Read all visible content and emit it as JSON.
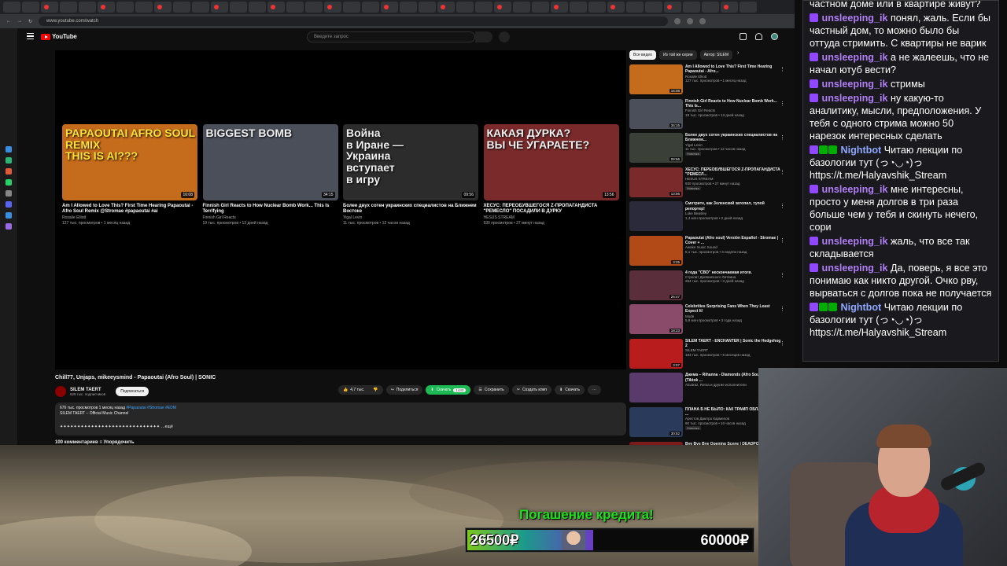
{
  "browser": {
    "url": "www.youtube.com/watch",
    "tab_count": 40
  },
  "youtube": {
    "logo": "YouTube",
    "search_placeholder": "Введите запрос",
    "end_cards": [
      {
        "thumb_text": "PAPAOUTAI AFRO SOUL REMIX\nTHIS IS AI???",
        "duration": "16:08",
        "title": "Am I Allowed to Love This? First Time Hearing Papaoutai - Afro Soul Remix @Stromae #papaoutai #ai",
        "channel": "Rosalie Elliott",
        "meta": "127 тыс. просмотров • 1 месяц назад",
        "bg": "#c46b1c"
      },
      {
        "thumb_text": "BIGGEST BOMB",
        "duration": "34:15",
        "title": "Finnish Girl Reacts to How Nuclear Bomb Work... This Is Terrifying",
        "channel": "Finnish Girl Reacts",
        "meta": "19 тыс. просмотров • 13 дней назад",
        "bg": "#4a4f5a"
      },
      {
        "thumb_text": "Война\nв Иране —\nУкраина\nвступает\nв игру",
        "duration": "09:56",
        "title": "Более двух сотен украинских специалистов на Ближнем Востоке",
        "channel": "Yigal Levin",
        "meta": "11 тыс. просмотров • 12 часов назад",
        "bg": "#2c2c2c"
      },
      {
        "thumb_text": "КАКАЯ ДУРКА?\nВЫ ЧЕ УГАРАЕТЕ?",
        "duration": "13:56",
        "title": "ХЕСУС: ПЕРЕОБУВШЕГОСЯ Z-ПРОПАГАНДИСТА \"РЕМЕСЛО\" ПОСАДИЛИ В ДУРКУ",
        "channel": "HESUS STREAM",
        "meta": "930 просмотров • 27 минут назад",
        "bg": "#7a2a2a"
      }
    ],
    "video_title": "Chill77, Unjaps, mikeeysmind - Papaoutai (Afro Soul) | SONIC",
    "channel_name": "SILEM TAERT",
    "channel_subs": "625 тыс. подписчиков",
    "subscribe_label": "Подписаться",
    "likes": "4,7 тыс.",
    "share_label": "Поделиться",
    "download_green_label": "Скачать",
    "download_green_count": "1440",
    "save_label": "Сохранить",
    "clip_label": "Создать клип",
    "download_label": "Скачать",
    "description_stats": "676 тыс. просмотров  1 месяц назад",
    "description_tags": "#Papaoutai #Stromae #EDM",
    "description_line2": "SILEM TAERT – Official Music Channel",
    "description_more": "✦✦✦✦✦✦✦✦✦✦✦✦✦✦✦✦✦✦✦✦✦✦✦✦✦✦✦✦✦ ...ещё",
    "comments_label": "100 комментариев   ≡ Упорядочить",
    "chips": [
      "Все видео",
      "Из той же серии",
      "Автор: SILEM"
    ],
    "recommendations": [
      {
        "title": "Am I Allowed to Love This? First Time Hearing Papaoutai - Afro...",
        "channel": "Rosalie Elliott",
        "meta": "127 тыс. просмотров • 1 месяц назад",
        "duration": "16:08",
        "bg": "#c46b1c"
      },
      {
        "title": "Finnish Girl Reacts to How Nuclear Bomb Work... This Is...",
        "channel": "Finnish Girl Reacts",
        "meta": "19 тыс. просмотров • 13 дней назад",
        "duration": "34:15",
        "bg": "#4a4f5a"
      },
      {
        "title": "Более двух сотен украинских специалистов на Ближнем...",
        "channel": "Yigal Levin",
        "meta": "11 тыс. просмотров • 12 часов назад",
        "duration": "09:56",
        "badge": "Новинка",
        "bg": "#3a3f38"
      },
      {
        "title": "ХЕСУС: ПЕРЕОБУВШЕГОСЯ Z-ПРОПАГАНДИСТА \"РЕМЕСЛ...",
        "channel": "HESUS STREAM",
        "meta": "930 просмотров • 27 минут назад",
        "duration": "13:56",
        "badge": "Новинка",
        "bg": "#7a2a2a"
      },
      {
        "title": "Смотрите, как Зеленский затопил, тупой репортер!",
        "channel": "Luke Beasley",
        "meta": "1,4 млн просмотров • 2 дней назад",
        "duration": "",
        "bg": "#2a2a3a"
      },
      {
        "title": "Papaoutai (Afro soul) Versión Español - Stromae | Cover + ...",
        "channel": "Awake music Sound",
        "meta": "5,1 тыс. просмотров • 3 недели назад",
        "duration": "3:25",
        "bg": "#b24a18"
      },
      {
        "title": "4 года \"СВО\" нескончаемая итогв.",
        "channel": "Стрелит Дневничного Литвина",
        "meta": "254 тыс. просмотров • 3 дней назад",
        "duration": "26:47",
        "bg": "#5a2e3a"
      },
      {
        "title": "Celebrities Surprising Fans When They Least Expect It!",
        "channel": "Mode",
        "meta": "5,9 млн просмотров • 3 года назад",
        "duration": "18:23",
        "bg": "#8a4a6a"
      },
      {
        "title": "SILEM TAERT - ENCHANTER | Sonic the Hedgehog 2",
        "channel": "SILEM TAERT",
        "meta": "183 тыс. просмотров • 5 месяцев назад",
        "duration": "3:07",
        "bg": "#b81c1c"
      },
      {
        "title": "Джема – Rihanna - Diamonds (Afro Soul Cover) (Tiktok ...",
        "channel": "Alcatraz, Rema и другие исполнители",
        "meta": "",
        "duration": "",
        "bg": "#5a3a6a"
      },
      {
        "title": "ПЛАНА Б НЕ БЫЛО: КАК ТРАМП ОБЛАЖАЛСЯ С ...",
        "channel": "Арестов Дмитро Кармелов",
        "meta": "90 тыс. просмотров • 10 часов назад",
        "duration": "30:52",
        "badge": "Новинка",
        "bg": "#2a3a5a"
      },
      {
        "title": "Bye Bye Bye Opening Scene | DEADPOOL & WOLVERINE ...",
        "channel": "JoBlo Movie Clips",
        "meta": "",
        "duration": "",
        "bg": "#7a1a1a"
      }
    ]
  },
  "chat": {
    "messages": [
      {
        "user": "",
        "text": "частном доме или в квартире живут?",
        "type": "continuation"
      },
      {
        "user": "unsleeping_ik",
        "text": "понял, жаль. Если бы частный дом, то можно было бы оттуда стримить. С квартиры не варик",
        "type": "user"
      },
      {
        "user": "unsleeping_ik",
        "text": "а не жалеешь, что не начал ютуб вести?",
        "type": "user"
      },
      {
        "user": "unsleeping_ik",
        "text": "стримы",
        "type": "user"
      },
      {
        "user": "unsleeping_ik",
        "text": "ну какую-то аналитику, мысли, предположения. У тебя с одного стрима можно 50 нарезок интересных сделать",
        "type": "user"
      },
      {
        "user": "Nightbot",
        "text": "Читаю лекции по базологии тут (っ◔◡◔)っ https://t.me/Halyavshik_Stream",
        "type": "bot"
      },
      {
        "user": "unsleeping_ik",
        "text": "мне интересны, просто у меня долгов в три раза больше чем у тебя и скинуть нечего, сори",
        "type": "user"
      },
      {
        "user": "unsleeping_ik",
        "text": "жаль, что все так складывается",
        "type": "user"
      },
      {
        "user": "unsleeping_ik",
        "text": "Да, поверь, я все это понимаю как никто другой. Очко рву, вырваться с долгов пока не получается",
        "type": "user"
      },
      {
        "user": "Nightbot",
        "text": "Читаю лекции по базологии тут (っ◔◡◔)っ https://t.me/Halyavshik_Stream",
        "type": "bot"
      }
    ]
  },
  "donation_goal": {
    "title": "Погашение кредита!",
    "current": "26500₽",
    "target": "60000₽",
    "progress": 0.4417
  },
  "colors": {
    "chat_user": "#b07ef5",
    "chat_bot": "#8fa8ff",
    "goal_title": "#1fe01f",
    "yt_red": "#ff0000",
    "download_green": "#1db954"
  }
}
